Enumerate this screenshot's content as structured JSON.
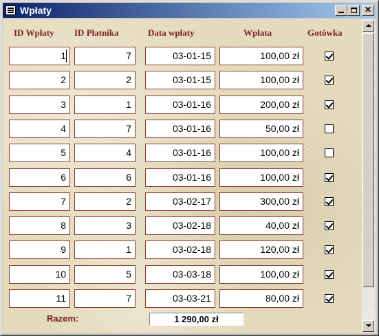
{
  "window": {
    "title": "Wpłaty",
    "icon": "form-icon"
  },
  "columns": {
    "id": "ID Wpłaty",
    "payer": "ID Płatnika",
    "date": "Data wpłaty",
    "amount": "Wpłata",
    "cash": "Gotówka"
  },
  "rows": [
    {
      "id": "1",
      "payer": "7",
      "date": "03-01-15",
      "amount": "100,00 zł",
      "cash": true
    },
    {
      "id": "2",
      "payer": "2",
      "date": "03-01-15",
      "amount": "100,00 zł",
      "cash": true
    },
    {
      "id": "3",
      "payer": "1",
      "date": "03-01-16",
      "amount": "200,00 zł",
      "cash": true
    },
    {
      "id": "4",
      "payer": "7",
      "date": "03-01-16",
      "amount": "50,00 zł",
      "cash": false
    },
    {
      "id": "5",
      "payer": "4",
      "date": "03-01-16",
      "amount": "100,00 zł",
      "cash": false
    },
    {
      "id": "6",
      "payer": "6",
      "date": "03-01-16",
      "amount": "100,00 zł",
      "cash": true
    },
    {
      "id": "7",
      "payer": "2",
      "date": "03-02-17",
      "amount": "300,00 zł",
      "cash": true
    },
    {
      "id": "8",
      "payer": "3",
      "date": "03-02-18",
      "amount": "40,00 zł",
      "cash": true
    },
    {
      "id": "9",
      "payer": "1",
      "date": "03-02-18",
      "amount": "120,00 zł",
      "cash": true
    },
    {
      "id": "10",
      "payer": "5",
      "date": "03-03-18",
      "amount": "100,00 zł",
      "cash": true
    },
    {
      "id": "11",
      "payer": "7",
      "date": "03-03-21",
      "amount": "80,00 zł",
      "cash": true
    }
  ],
  "footer": {
    "label": "Razem:",
    "total": "1 290,00 zł"
  },
  "colors": {
    "header_text": "#7a1e1e",
    "field_border": "#8b3a2a",
    "background": "#e6dcbe",
    "titlebar": "#0a246a"
  }
}
